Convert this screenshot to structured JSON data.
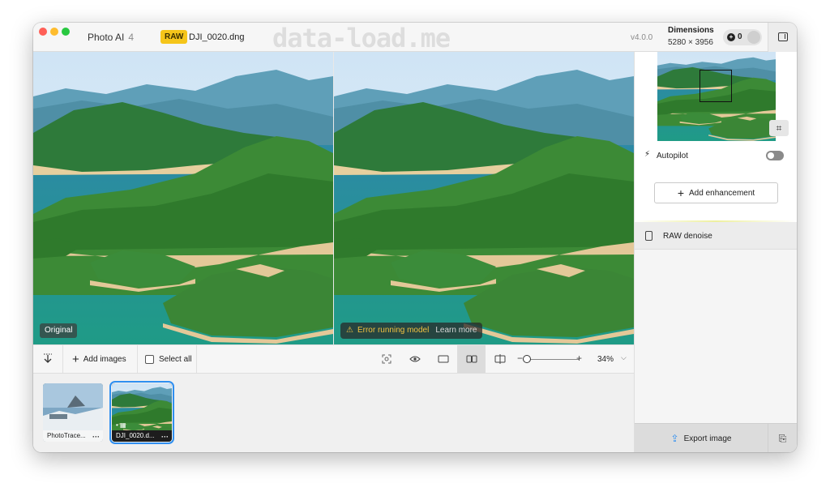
{
  "titlebar": {
    "app_name": "Photo AI",
    "app_major_version": "4",
    "raw_badge": "RAW",
    "file_name": "DJI_0020.dng",
    "watermark": "data-load.me",
    "app_version": "v4.0.0",
    "dimensions_label": "Dimensions",
    "dimensions_value": "5280 × 3956",
    "credits": "0"
  },
  "viewer": {
    "left_label": "Original",
    "error_text": "Error running model",
    "learn_more": "Learn more"
  },
  "toolbar": {
    "add_images": "Add images",
    "select_all": "Select all",
    "zoom": "34%",
    "zoom_level": 0.07
  },
  "filmstrip": {
    "items": [
      {
        "label": "PhotoTrace...",
        "selected": false
      },
      {
        "label": "DJI_0020.d...",
        "selected": true
      }
    ]
  },
  "right_panel": {
    "autopilot_label": "Autopilot",
    "autopilot_on": false,
    "add_enhancement": "Add enhancement",
    "enhancements": [
      {
        "label": "RAW denoise"
      }
    ],
    "export_label": "Export image"
  },
  "colors": {
    "accent": "#2f8ff0",
    "raw_badge": "#f5c51a",
    "warning": "#f0c040"
  },
  "icons": [
    "download-icon",
    "plus-icon",
    "checkbox-icon",
    "face-detect-icon",
    "eye-icon",
    "single-view-icon",
    "side-by-side-icon",
    "split-view-icon",
    "crop-icon",
    "bolt-icon",
    "document-icon",
    "share-icon",
    "panel-toggle-icon"
  ]
}
